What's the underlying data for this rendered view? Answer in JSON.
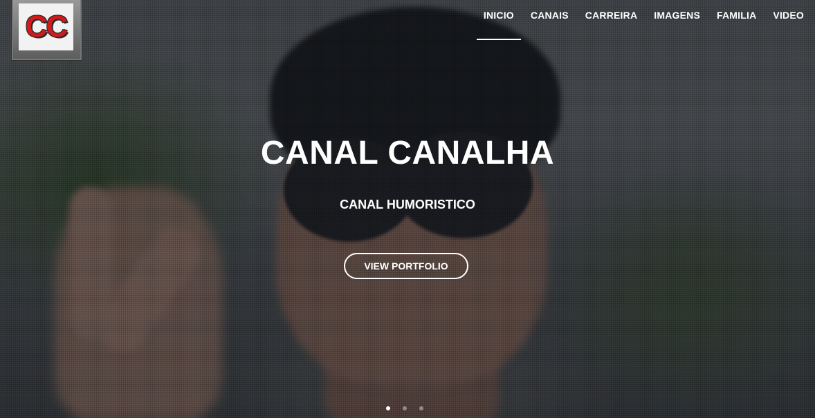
{
  "logo": {
    "text": "CC",
    "icon": "cc-logo-icon",
    "color": "#d11a1a"
  },
  "nav": {
    "items": [
      {
        "label": "INICIO",
        "active": true
      },
      {
        "label": "CANAIS",
        "active": false
      },
      {
        "label": "CARREIRA",
        "active": false
      },
      {
        "label": "IMAGENS",
        "active": false
      },
      {
        "label": "FAMILIA",
        "active": false
      },
      {
        "label": "VIDEO",
        "active": false
      }
    ]
  },
  "hero": {
    "title": "CANAL CANALHA",
    "subtitle": "CANAL HUMORISTICO",
    "cta_label": "VIEW PORTFOLIO"
  },
  "slider": {
    "slide_count": 3,
    "active_index": 0
  }
}
